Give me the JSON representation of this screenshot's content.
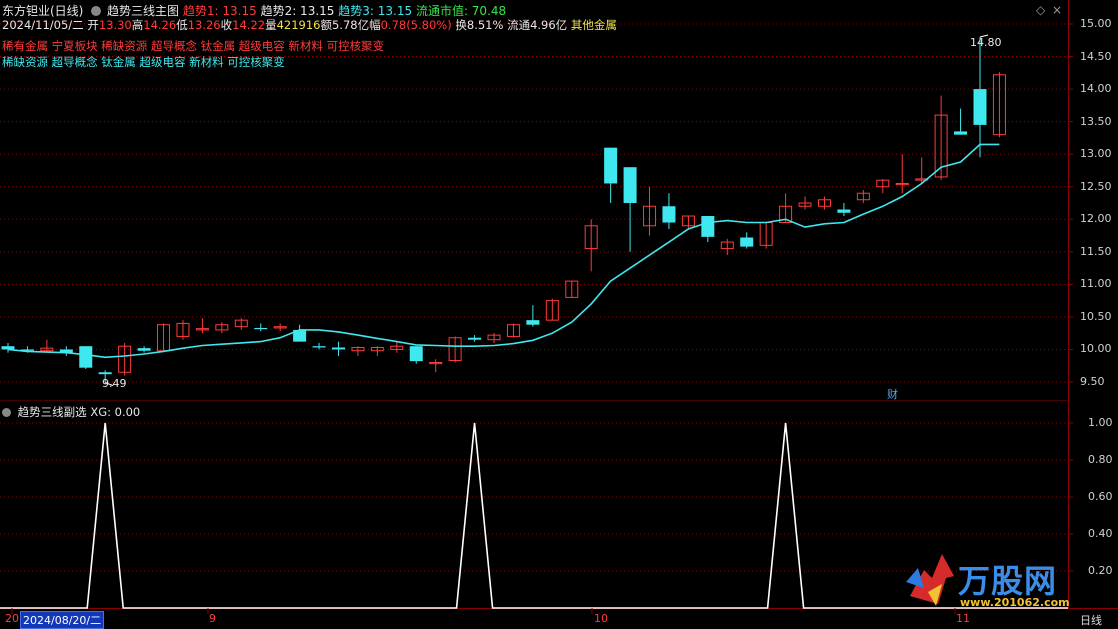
{
  "header": {
    "stock_name": "东方钽业(日线)",
    "indicator_name": "趋势三线主图",
    "trend1": "趋势1: 13.15",
    "trend2": "趋势2: 13.15",
    "trend3": "趋势3: 13.15",
    "market_cap": "流通市值: 70.48"
  },
  "quote": {
    "date": "2024/11/05/二",
    "open_label": "开",
    "open": "13.30",
    "high_label": "高",
    "high": "14.26",
    "low_label": "低",
    "low": "13.26",
    "close_label": "收",
    "close": "14.22",
    "volume_label": "量",
    "volume": "421916",
    "amount_label": "额",
    "amount": "5.78亿",
    "change_label": "幅",
    "change": "0.78(5.80%)",
    "turnover": "换8.51%",
    "float_shares": "流通4.96亿",
    "sector": "其他金属"
  },
  "concepts_line1": "稀有金属 宁夏板块 稀缺资源 超导概念 钛金属 超级电容 新材料 可控核聚变",
  "concepts_line2": "稀缺资源 超导概念 钛金属 超级电容 新材料 可控核聚变",
  "sub_panel": {
    "title": "趋势三线副选",
    "xg": "XG: 0.00"
  },
  "annotations": {
    "high_label": "14.80",
    "low_label": "9.49",
    "finance_marker": "财"
  },
  "x_axis": {
    "date_box": "2024/08/20/二",
    "month_9": "9",
    "month_10": "10",
    "month_11": "11",
    "left_cut": "20",
    "period": "日线"
  },
  "watermark": {
    "brand": "万股网",
    "url": "www.201062.com"
  },
  "colors": {
    "up": "#ff3b3b",
    "down": "#3ee8ee",
    "ma": "#3ee8ee",
    "grid": "#8a0000",
    "signal": "#ffffff"
  },
  "chart_data": [
    {
      "type": "candlestick",
      "y_ticks": [
        "15.00",
        "14.50",
        "14.00",
        "13.50",
        "13.00",
        "12.50",
        "12.00",
        "11.50",
        "11.00",
        "10.50",
        "10.00",
        "9.50"
      ],
      "ylim": [
        9.25,
        15.2
      ],
      "candles": [
        [
          10.05,
          10.1,
          9.95,
          10.0
        ],
        [
          10.0,
          10.05,
          9.95,
          9.98
        ],
        [
          9.98,
          10.15,
          9.95,
          10.02
        ],
        [
          10.0,
          10.05,
          9.9,
          9.95
        ],
        [
          10.05,
          10.05,
          9.7,
          9.72
        ],
        [
          9.65,
          9.68,
          9.49,
          9.62
        ],
        [
          9.65,
          10.1,
          9.6,
          10.05
        ],
        [
          10.02,
          10.05,
          9.95,
          9.98
        ],
        [
          9.98,
          10.4,
          9.97,
          10.38
        ],
        [
          10.2,
          10.45,
          10.15,
          10.4
        ],
        [
          10.3,
          10.48,
          10.25,
          10.32
        ],
        [
          10.3,
          10.42,
          10.25,
          10.38
        ],
        [
          10.35,
          10.48,
          10.3,
          10.45
        ],
        [
          10.33,
          10.4,
          10.28,
          10.32
        ],
        [
          10.33,
          10.4,
          10.28,
          10.35
        ],
        [
          10.3,
          10.38,
          10.12,
          10.12
        ],
        [
          10.05,
          10.1,
          10.0,
          10.03
        ],
        [
          10.03,
          10.12,
          9.9,
          10.0
        ],
        [
          9.98,
          10.05,
          9.9,
          10.03
        ],
        [
          9.98,
          10.05,
          9.9,
          10.03
        ],
        [
          10.0,
          10.12,
          9.95,
          10.05
        ],
        [
          10.05,
          10.05,
          9.78,
          9.82
        ],
        [
          9.8,
          9.85,
          9.65,
          9.8
        ],
        [
          9.83,
          10.2,
          9.8,
          10.18
        ],
        [
          10.18,
          10.22,
          10.12,
          10.15
        ],
        [
          10.15,
          10.25,
          10.1,
          10.22
        ],
        [
          10.2,
          10.4,
          10.18,
          10.38
        ],
        [
          10.45,
          10.68,
          10.35,
          10.38
        ],
        [
          10.45,
          10.78,
          10.45,
          10.75
        ],
        [
          10.8,
          11.05,
          10.8,
          11.05
        ],
        [
          11.55,
          12.0,
          11.2,
          11.9
        ],
        [
          13.1,
          13.1,
          12.25,
          12.55
        ],
        [
          12.8,
          12.8,
          11.5,
          12.25
        ],
        [
          11.9,
          12.5,
          11.75,
          12.2
        ],
        [
          12.2,
          12.4,
          11.85,
          11.95
        ],
        [
          11.9,
          12.05,
          11.85,
          12.05
        ],
        [
          12.05,
          12.05,
          11.65,
          11.73
        ],
        [
          11.55,
          11.7,
          11.45,
          11.65
        ],
        [
          11.72,
          11.8,
          11.55,
          11.58
        ],
        [
          11.6,
          11.95,
          11.55,
          11.95
        ],
        [
          11.95,
          12.4,
          11.95,
          12.2
        ],
        [
          12.2,
          12.35,
          12.15,
          12.25
        ],
        [
          12.2,
          12.35,
          12.15,
          12.3
        ],
        [
          12.15,
          12.25,
          12.05,
          12.1
        ],
        [
          12.3,
          12.45,
          12.25,
          12.4
        ],
        [
          12.5,
          12.62,
          12.4,
          12.6
        ],
        [
          12.55,
          13.0,
          12.4,
          12.55
        ],
        [
          12.62,
          12.95,
          12.55,
          12.62
        ],
        [
          12.65,
          13.9,
          12.6,
          13.6
        ],
        [
          13.35,
          13.7,
          13.3,
          13.3
        ],
        [
          14.0,
          14.8,
          12.95,
          13.45
        ],
        [
          13.3,
          14.26,
          13.26,
          14.22
        ]
      ],
      "ma_line": [
        10.0,
        9.97,
        9.96,
        9.95,
        9.92,
        9.88,
        9.9,
        9.93,
        9.97,
        10.02,
        10.06,
        10.08,
        10.1,
        10.12,
        10.18,
        10.3,
        10.3,
        10.27,
        10.22,
        10.17,
        10.12,
        10.07,
        10.06,
        10.05,
        10.05,
        10.06,
        10.09,
        10.14,
        10.25,
        10.42,
        10.7,
        11.05,
        11.25,
        11.45,
        11.65,
        11.85,
        11.95,
        11.98,
        11.95,
        11.95,
        12.0,
        11.88,
        11.93,
        11.95,
        12.08,
        12.2,
        12.35,
        12.55,
        12.8,
        12.88,
        13.15,
        13.15
      ]
    },
    {
      "type": "line",
      "title": "趋势三线副选",
      "y_ticks": [
        "1.00",
        "0.80",
        "0.60",
        "0.40",
        "0.20"
      ],
      "ylim": [
        0,
        1.0
      ],
      "x": [
        0,
        4,
        5,
        6,
        7,
        8,
        10,
        12,
        15,
        18,
        20,
        22,
        24,
        26,
        27,
        28,
        29,
        30,
        31,
        35,
        40,
        45,
        48,
        49,
        50,
        51
      ],
      "values": [
        0,
        0,
        0,
        1,
        0,
        0,
        0,
        0,
        0,
        0,
        0,
        0,
        0,
        0,
        1,
        0,
        0,
        0,
        0,
        0,
        0,
        0,
        0,
        0,
        0,
        0
      ],
      "spikes_at": [
        5,
        24,
        40
      ]
    }
  ]
}
